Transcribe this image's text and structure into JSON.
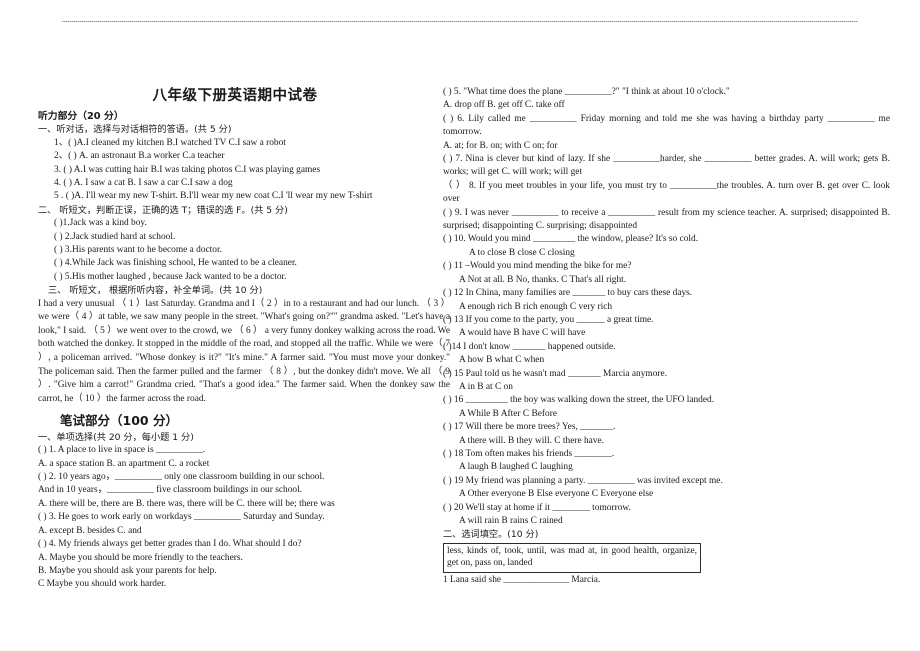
{
  "document": {
    "title": "八年级下册英语期中试卷"
  },
  "left_column": {
    "listening_header": "听力部分（20 分）",
    "section_one_head": "一、听对话，选择与对话相符的答语。(共 5 分)",
    "section_one_items": [
      "1、(      )A.I cleaned my kitchen      B.I watched TV      C.I saw a robot",
      "2、(      ) A. an astronaut      B.a worker          C.a teacher",
      "3.  (      ) A.I was cutting hair          B.I was taking photos          C.I was playing games",
      "4.  (      ) A. I saw a cat       B. I saw a car       C.I saw a dog",
      "5 . (      )A. I'll wear my new T-shirt.  B.I'll wear my new coat   C.I 'll  wear my new T-shirt"
    ],
    "section_two_head": "二、 听短文，判断正误，正确的选 T；错误的选 F。(共 5 分)",
    "section_two_items": [
      "(      )1.Jack was a kind boy.",
      "(      ) 2.Jack studied hard at school.",
      "(      ) 3.His parents want to he become a doctor.",
      "(      ) 4.While Jack was finishing school, He wanted to be a cleaner.",
      "(      ) 5.His mother laughed , because Jack wanted to be a doctor."
    ],
    "section_three_head": "三、    听短文，  根据所听内容，补全单词。(共 10 分)",
    "passage": "I had a very unusual  （  1      ）last Saturday. Grandma and I（  2    ）in to a restaurant and had our lunch. （  3      ）we were（  4      ）at table, we saw many people in the street. \"What's going on?\"\" grandma asked. \"Let's have a look,\" I said. （  5        ）we went over to the crowd, we  （   6     ） a very funny donkey walking across the road. We both watched the donkey. It stopped in the middle of the road, and stopped all the traffic. While we were（    7     ）, a policeman arrived. \"Whose donkey is it?\" \"It's mine.\" A farmer said. \"You must move your donkey.\" The policeman said. Then the farmer pulled and the farmer  （     8     ）, but the donkey didn't move. We all （   9     ）. \"Give him a carrot!\" Grandma cried. \"That's a good idea.\" The farmer said. When the donkey saw the carrot, he（   10      ）the farmer across the road.",
    "written_header": "笔试部分（100 分）",
    "section_choice_head": "一、单项选择(共 20 分，每小题 1 分)",
    "choice_items": [
      "(  ) 1. A place to live in space is __________.",
      "A. a space station     B. an apartment        C. a rocket",
      "(  ) 2. 10 years ago，__________ only one classroom building in our school.",
      "And in 10 years，__________ five classroom buildings in our school.",
      "A. there will be, there are   B. there was, there will be         C. there will be; there was",
      "(  ) 3. He goes to work early on workdays __________ Saturday and Sunday.",
      "A. except          B. besides            C. and",
      "(  ) 4. My friends always get better grades than I do. What should I do?",
      "A.      Maybe you should be more friendly to the teachers.",
      "B.      Maybe you should ask your parents for help.",
      "C  Maybe you should work harder."
    ]
  },
  "right_column": {
    "choice_items": [
      "(  ) 5. \"What time does the plane __________?\" \"I think at about 10 o'clock.\"",
      "A. drop off       B. get off          C. take off",
      "(  ) 6. Lily called me __________ Friday morning and told me she was having a birthday party __________ me tomorrow.",
      "A. at; for        B. on; with           C  on; for",
      "(  ) 7. Nina is clever but kind of lazy. If she __________harder, she __________ better grades.                    A. will work; gets  B. works; will get     C. will work; will get",
      "（      ）  8. If you meet troubles in your life, you must try to __________the troubles.                           A. turn over       B. get over       C. look over",
      "(  ) 9. I was never __________ to receive a __________ result from my science teacher.                         A. surprised; disappointed       B. surprised; disappointing   C. surprising; disappointed",
      "(  ) 10. Would you mind _________ the window, please? It's so cold.",
      "A to close           B close             C closing",
      "(  ) 11 –Would you mind mending the bike for me?",
      "A Not at all.        B No, thanks.        C That's all right.",
      "(  ) 12 In China, many families are _______ to buy cars these days.",
      "A enough rich        B rich enough         C very rich",
      "(  ) 13 If you come to the party, you ______ a great time.",
      "A would have       B have             C will have",
      "(  )14 I don't know _______ happened outside.",
      "A how             B what             C when",
      "(  ) 15 Paul told us he wasn't mad _______ Marcia anymore.",
      "A in               B at               C on",
      "(  ) 16 _________ the boy was walking down the street, the UFO landed.",
      "A While            B After             C Before",
      "(  ) 17 Will there be more trees? Yes, _______.",
      "A there will.        B they will.         C there have.",
      "(  ) 18 Tom often makes his friends ________.",
      "A laugh             B laughed           C laughing",
      "(  ) 19 My friend was planning a party. __________ was invited except me.",
      "A Other everyone     B Else everyone      C Everyone else",
      "(  ) 20 We'll stay at home if it ________ tomorrow.",
      "A will rain          B rains             C rained"
    ],
    "section_fill_head": "二、选词填空。(10 分)",
    "word_bank": "less,    kinds of,    took,    until,    was mad at,     in good health,   organize,   get on,   pass on,   landed",
    "fill_item_1": "1 Lana said she ______________ Marcia."
  }
}
